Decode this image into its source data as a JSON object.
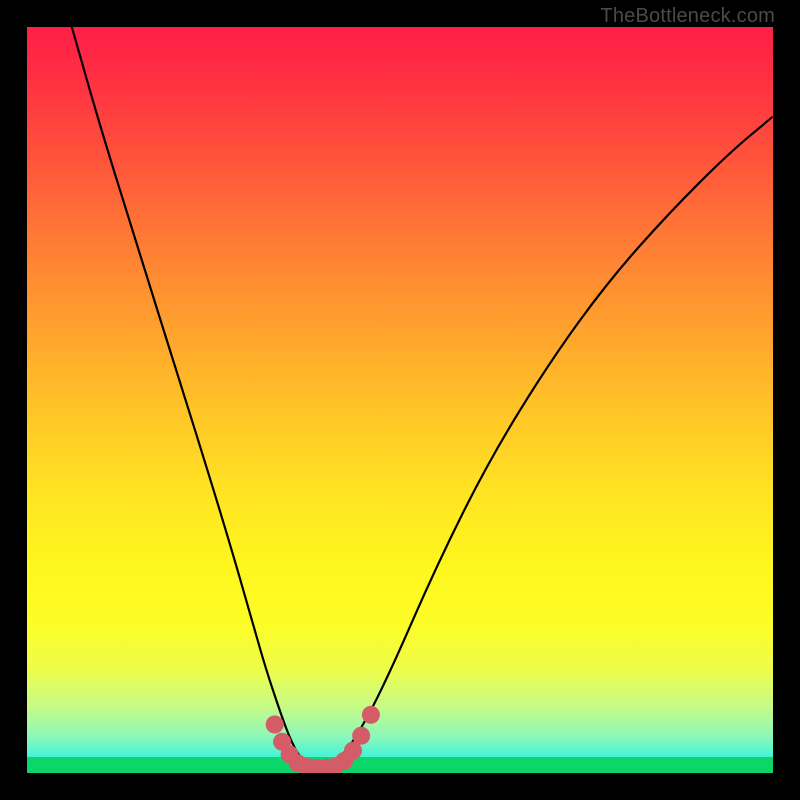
{
  "watermark": "TheBottleneck.com",
  "chart_data": {
    "type": "line",
    "title": "",
    "xlabel": "",
    "ylabel": "",
    "xlim": [
      0,
      100
    ],
    "ylim": [
      0,
      100
    ],
    "grid": false,
    "legend": false,
    "annotations": [],
    "series": [
      {
        "name": "curve",
        "x": [
          6,
          10,
          15,
          20,
          25,
          28,
          30,
          32,
          34,
          35.5,
          37,
          38.5,
          40,
          41.5,
          44,
          48,
          55,
          62,
          70,
          78,
          86,
          94,
          100
        ],
        "y": [
          100,
          86,
          70,
          54,
          38,
          28,
          21,
          14,
          8,
          4,
          1.5,
          0.7,
          0.7,
          1.5,
          4.5,
          12,
          28,
          42,
          55,
          66,
          75,
          83,
          88
        ]
      }
    ],
    "marker_cluster": {
      "color": "#d35c66",
      "points": [
        {
          "x": 33.2,
          "y": 6.5
        },
        {
          "x": 34.2,
          "y": 4.2
        },
        {
          "x": 35.2,
          "y": 2.5
        },
        {
          "x": 36.3,
          "y": 1.3
        },
        {
          "x": 37.5,
          "y": 0.8
        },
        {
          "x": 38.7,
          "y": 0.7
        },
        {
          "x": 40.0,
          "y": 0.7
        },
        {
          "x": 41.2,
          "y": 0.8
        },
        {
          "x": 42.5,
          "y": 1.6
        },
        {
          "x": 43.7,
          "y": 3.0
        },
        {
          "x": 44.8,
          "y": 5.0
        },
        {
          "x": 46.1,
          "y": 7.8
        }
      ]
    },
    "background_gradient": {
      "top_color": "#ff1f47",
      "bottom_color": "#15f0e0",
      "mid_color": "#ffe322"
    }
  }
}
